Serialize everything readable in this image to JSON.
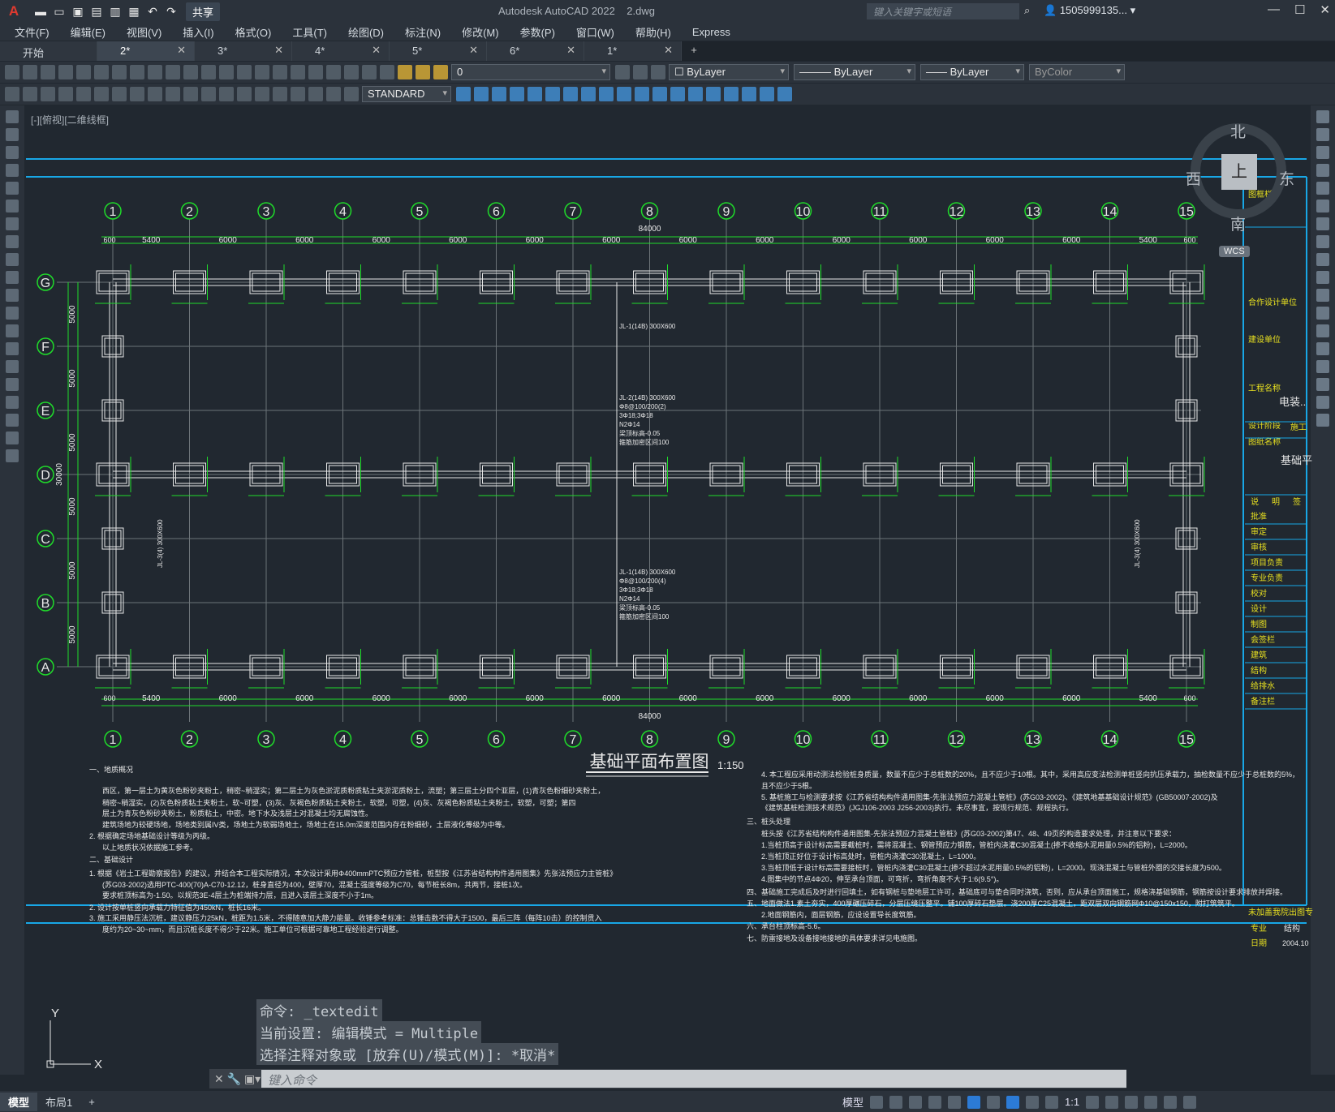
{
  "app": {
    "title": "Autodesk AutoCAD 2022",
    "file": "2.dwg",
    "share_label": "共享",
    "search_placeholder": "键入关键字或短语",
    "user": "1505999135..."
  },
  "menu": [
    "文件(F)",
    "编辑(E)",
    "视图(V)",
    "插入(I)",
    "格式(O)",
    "工具(T)",
    "绘图(D)",
    "标注(N)",
    "修改(M)",
    "参数(P)",
    "窗口(W)",
    "帮助(H)",
    "Express"
  ],
  "tabs": [
    {
      "label": "开始",
      "close": false,
      "active": false
    },
    {
      "label": "2*",
      "close": true,
      "active": true
    },
    {
      "label": "3*",
      "close": true,
      "active": false
    },
    {
      "label": "4*",
      "close": true,
      "active": false
    },
    {
      "label": "5*",
      "close": true,
      "active": false
    },
    {
      "label": "6*",
      "close": true,
      "active": false
    },
    {
      "label": "1*",
      "close": true,
      "active": false
    }
  ],
  "toolbar": {
    "layer": "0",
    "color": "ByLayer",
    "linetype": "ByLayer",
    "lineweight": "ByLayer",
    "plotstyle": "ByColor",
    "textstyle": "STANDARD"
  },
  "viewport_label": "[-][俯视][二维线框]",
  "viewcube": {
    "north": "北",
    "south": "南",
    "east": "东",
    "west": "西",
    "top": "上",
    "wcs": "WCS"
  },
  "drawing": {
    "title": "基础平面布置图",
    "scale": "1:150",
    "grid_cols": [
      "1",
      "2",
      "3",
      "4",
      "5",
      "6",
      "7",
      "8",
      "9",
      "10",
      "11",
      "12",
      "13",
      "14",
      "15"
    ],
    "grid_rows": [
      "G",
      "F",
      "E",
      "D",
      "C",
      "B",
      "A"
    ],
    "col_spacing": [
      "5400",
      "6000",
      "6000",
      "6000",
      "6000",
      "6000",
      "6000",
      "6000",
      "6000",
      "6000",
      "6000",
      "6000",
      "6000",
      "5400"
    ],
    "total_length": "84000",
    "end_offset": "600",
    "row_spacing": "5000",
    "total_height": "30000",
    "beam_notes": [
      "JL-1(14B) 300X600",
      "JL-2(14B) 300X600",
      "Φ8@100/200(2)",
      "3Φ18;3Φ18",
      "N2Φ14",
      "梁顶标高-0.05",
      "箍筋加密区间100",
      "JL-1(14B) 300X600",
      "Φ8@100/200(4)",
      "3Φ18;3Φ18",
      "N2Φ14",
      "梁顶标高-0.05",
      "箍筋加密区间100",
      "JL-3(4) 300X600"
    ],
    "notes_left": [
      "一、地质概况",
      "西区，第一层土为黄灰色粉砂夹粉土，稍密~稍湿实；第二层土为灰色淤泥质粉质粘土夹淤泥质粉土，流塑；第三层土分四个亚层，(1)青灰色粉细砂夹粉土，",
      "稍密~稍湿实，(2)灰色粉质粘土夹粉土，软~可塑，(3)灰、灰褐色粉质粘土夹粉土，软塑，可塑，(4)灰、灰褐色粉质粘土夹粉土，软塑，可塑；第四",
      "层土为青灰色粉砂夹粉土，粉质粘土，中密。地下水及浅层土对混凝土均无腐蚀性。",
      "建筑场地为较硬场地，场地类别属IV类，场地土为软弱场地土，场地土在15.0m深度范围内存在粉细砂，土层液化等级为中等。",
      "2. 根据确定场地基础设计等级为丙级。",
      "以上地质状况依据施工参考。",
      "二、基础设计",
      "1. 根据《岩土工程勘察报告》的建议，并结合本工程实际情况，本次设计采用Φ400mmPTC预应力管桩，桩型按《江苏省结构构件通用图集》先张法预应力主管桩》",
      "(苏G03-2002)选用PTC-400(70)A-C70-12.12，桩身直径为400，壁厚70，混凝土强度等级为C70，每节桩长8m，共两节，接桩1次。",
      "要求桩顶标高为-1.50。以规范3E-4层土为桩端持力层，且进入该层土深度不小于1m。",
      "2. 设计按单桩竖向承载力特征值为450kN，桩长16米。",
      "3. 施工采用静压法沉桩，建议静压力25kN，桩距为1.5米，不得随意加大静力能量。收锤参考标准：总锤击数不得大于1500，最后三阵（每阵10击）的控制贯入",
      "度约为20~30~mm，而且沉桩长度不得少于22米。施工单位可根据可靠地工程经验进行调整。"
    ],
    "notes_right": [
      "4. 本工程应采用动测法检验桩身质量，数量不应少于总桩数的20%，且不应少于10根。其中，采用高应变法检测单桩竖向抗压承载力，抽检数量不应少于总桩数的5%，",
      "且不应少于5根。",
      "5. 基桩施工与检测要求按《江苏省结构构件通用图集-先张法预应力混凝土管桩》(苏G03-2002)、《建筑地基基础设计规范》(GB50007-2002)及",
      "《建筑基桩检测技术规范》(JGJ106-2003 J256-2003)执行。未尽事宜，按现行规范、规程执行。",
      "三、桩头处理",
      "桩头按《江苏省结构构件通用图集-先张法预应力混凝土管桩》(苏G03-2002)第47、48、49页的构造要求处理，并注意以下要求：",
      "1.当桩顶高于设计标高需要截桩时，需将混凝土、钢管预应力钢筋，管桩内浇灌C30混凝土(掺不收缩水泥用量0.5%的铝粉)，L=2000。",
      "2.当桩顶正好位于设计标高处时，管桩内浇灌C30混凝土，L=1000。",
      "3.当桩顶低于设计标高需要接桩时，管桩内浇灌C30混凝土(掺不超过水泥用量0.5%的铝粉)，L=2000。现浇混凝土与管桩外圈的交接长度为500。",
      "4.图集中的节点4Φ20，伸至承台顶面，可弯折，弯折角度不大于1:6(9.5°)。",
      "四、基础施工完成后及时进行回填土，如有钢桩与垫地层工许可，基础底可与垫合同时浇筑，否则，应从承台顶面施工，规格浇基础钢筋，钢筋按设计要求排放并焊接。",
      "五、地面做法1.素土夯实，400厚碾压碎石，分层压缝压整平。铺100厚碎石垫层。浇200厚C25混凝土，距双层双向钢筋网Φ10@150x150，附打筑筑平。",
      "2.地面钢筋内，面层钢筋，应设设置导长度筑筋。",
      "六、承台柱顶标高-5.6。",
      "七、防雷接地及设备接地接地的具体要求详见电施图。"
    ]
  },
  "title_block": {
    "rows_top": [
      "图框栏",
      "合作设计单位",
      "建设单位",
      "工程名称",
      "电装..",
      "设计阶段",
      "施工",
      "图纸名称",
      "基础平"
    ],
    "rows_table": [
      "批准",
      "审定",
      "审核",
      "项目负责",
      "专业负责",
      "校对",
      "设计",
      "制图",
      "会签栏",
      "建筑",
      "结构",
      "给排水",
      "备注栏"
    ],
    "header_cols": [
      "说",
      "明",
      "签"
    ],
    "footer": {
      "note": "未加盖我院出图专",
      "major_label": "专业",
      "major": "结构",
      "date_label": "日期",
      "date": "2004.10"
    }
  },
  "command": {
    "history": [
      "命令: _textedit",
      "当前设置: 编辑模式 = Multiple",
      "选择注释对象或 [放弃(U)/模式(M)]: *取消*"
    ],
    "placeholder": "键入命令"
  },
  "status": {
    "tabs": [
      "模型",
      "布局1"
    ],
    "mode": "模型",
    "scale": "1:1"
  }
}
